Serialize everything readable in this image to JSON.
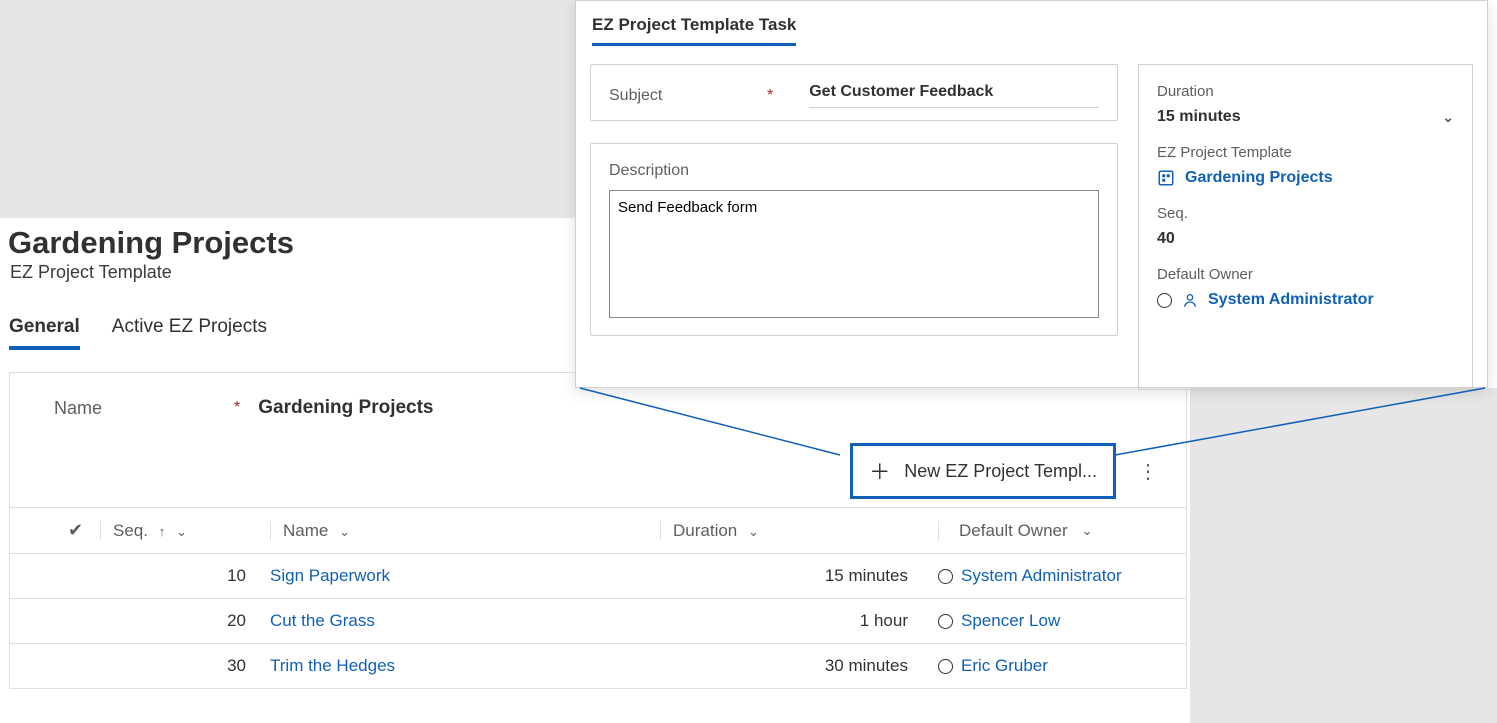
{
  "page": {
    "title": "Gardening Projects",
    "subtitle": "EZ Project Template"
  },
  "tabs": [
    {
      "label": "General",
      "active": true
    },
    {
      "label": "Active EZ Projects",
      "active": false
    }
  ],
  "nameField": {
    "label": "Name",
    "value": "Gardening Projects"
  },
  "subgrid": {
    "newButton": "New EZ Project Templ...",
    "columns": {
      "seq": "Seq.",
      "name": "Name",
      "duration": "Duration",
      "owner": "Default Owner"
    },
    "rows": [
      {
        "seq": "10",
        "name": "Sign Paperwork",
        "duration": "15 minutes",
        "owner": "System Administrator"
      },
      {
        "seq": "20",
        "name": "Cut the Grass",
        "duration": "1 hour",
        "owner": "Spencer Low"
      },
      {
        "seq": "30",
        "name": "Trim the Hedges",
        "duration": "30 minutes",
        "owner": "Eric Gruber"
      }
    ]
  },
  "popout": {
    "tabLabel": "EZ Project Template Task",
    "subject": {
      "label": "Subject",
      "value": "Get Customer Feedback"
    },
    "description": {
      "label": "Description",
      "value": "Send Feedback form"
    },
    "side": {
      "durationLabel": "Duration",
      "durationValue": "15 minutes",
      "templateLabel": "EZ Project Template",
      "templateValue": "Gardening Projects",
      "seqLabel": "Seq.",
      "seqValue": "40",
      "ownerLabel": "Default Owner",
      "ownerValue": "System Administrator"
    }
  }
}
